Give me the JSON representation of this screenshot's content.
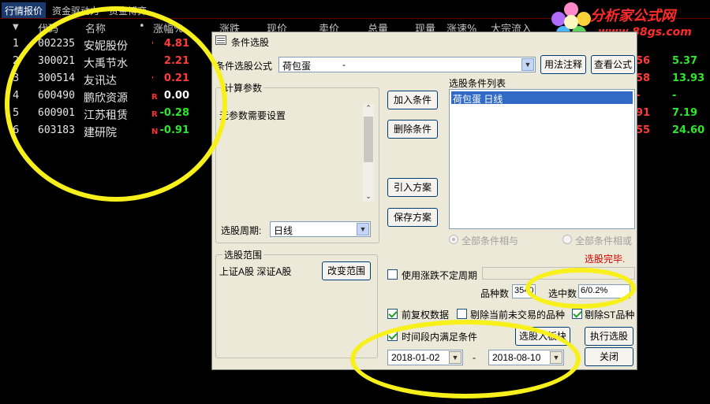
{
  "tabs": [
    "行情报价",
    "资金驱动力",
    "资金博弈"
  ],
  "headers": {
    "idx_mark": "▼",
    "code": "代码",
    "name": "名称",
    "dot": "•",
    "change": "涨幅%",
    "updown": "涨跌",
    "price": "现价",
    "sell": "卖价",
    "vol": "总量",
    "cur": "现量",
    "speed": "涨速%",
    "big": "大宗流入"
  },
  "rows": [
    {
      "idx": "1",
      "code": "002235",
      "name": "安妮股份",
      "tag": "'",
      "change": "4.81",
      "change_color": "#ff3b3b",
      "r1": "",
      "r2": ""
    },
    {
      "idx": "2",
      "code": "300021",
      "name": "大禹节水",
      "tag": "",
      "change": "2.21",
      "change_color": "#ff3b3b",
      "r1": "56",
      "r2": "5.37"
    },
    {
      "idx": "3",
      "code": "300514",
      "name": "友讯达",
      "tag": "'",
      "change": "0.21",
      "change_color": "#ff3b3b",
      "r1": "58",
      "r2": "13.93"
    },
    {
      "idx": "4",
      "code": "600490",
      "name": "鹏欣资源",
      "tag": "R",
      "change": "0.00",
      "change_color": "#ffffff",
      "r1": "-",
      "r2": "-"
    },
    {
      "idx": "5",
      "code": "600901",
      "name": "江苏租赁",
      "tag": "R",
      "change": "-0.28",
      "change_color": "#2ee62e",
      "r1": "91",
      "r2": "7.19"
    },
    {
      "idx": "6",
      "code": "603183",
      "name": "建研院",
      "tag": "N",
      "change": "-0.91",
      "change_color": "#2ee62e",
      "r1": "55",
      "r2": "24.60"
    }
  ],
  "logo": {
    "title": "分析家公式网",
    "url": "www.88gs.com"
  },
  "dialog": {
    "title": "条件选股",
    "formula_label": "条件选股公式",
    "formula_value": "荷包蛋",
    "formula_desc": "-",
    "usage_btn": "用法注释",
    "view_btn": "查看公式",
    "calc_group": "计算参数",
    "no_params": "无参数需要设置",
    "period_label": "选股周期:",
    "period_value": "日线",
    "add_btn": "加入条件",
    "del_btn": "删除条件",
    "import_btn": "引入方案",
    "save_btn": "保存方案",
    "list_label": "选股条件列表",
    "list_items": [
      "荷包蛋 日线"
    ],
    "radio_and": "全部条件相与",
    "radio_or": "全部条件相或",
    "status": "选股完毕.",
    "range_group": "选股范围",
    "range_value": "上证A股 深证A股",
    "change_range_btn": "改变范围",
    "use_period": "使用涨跌不定周期",
    "count_label": "品种数",
    "count_value": "3540",
    "selected_label": "选中数",
    "selected_value": "6/0.2%",
    "fq_label": "前复权数据",
    "exclude_untraded": "剔除当前未交易的品种",
    "exclude_st": "剔除ST品种",
    "time_label": "时间段内满足条件",
    "to_board_btn": "选股入板块",
    "run_btn": "执行选股",
    "date_from": "2018-01-02",
    "date_sep": "-",
    "date_to": "2018-08-10",
    "close_btn": "关闭"
  }
}
